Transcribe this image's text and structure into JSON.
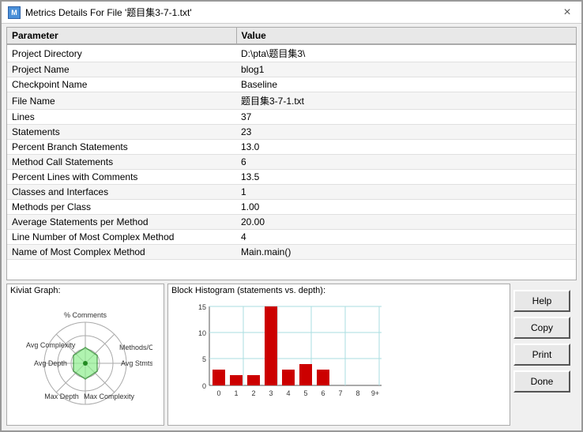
{
  "window": {
    "title": "Metrics Details For File '题目集3-7-1.txt'",
    "close_label": "×"
  },
  "table": {
    "col_param": "Parameter",
    "col_value": "Value",
    "rows": [
      {
        "param": "Project Directory",
        "value": "D:\\pta\\题目集3\\"
      },
      {
        "param": "Project Name",
        "value": "blog1"
      },
      {
        "param": "Checkpoint Name",
        "value": "Baseline"
      },
      {
        "param": "File Name",
        "value": "题目集3-7-1.txt"
      },
      {
        "param": "Lines",
        "value": "37"
      },
      {
        "param": "Statements",
        "value": "23"
      },
      {
        "param": "Percent Branch Statements",
        "value": "13.0"
      },
      {
        "param": "Method Call Statements",
        "value": "6"
      },
      {
        "param": "Percent Lines with Comments",
        "value": "13.5"
      },
      {
        "param": "Classes and Interfaces",
        "value": "1"
      },
      {
        "param": "Methods per Class",
        "value": "1.00"
      },
      {
        "param": "Average Statements per Method",
        "value": "20.00"
      },
      {
        "param": "Line Number of Most Complex Method",
        "value": "4"
      },
      {
        "param": "Name of Most Complex Method",
        "value": "Main.main()"
      }
    ]
  },
  "kiviat": {
    "label": "Kiviat Graph:",
    "labels": {
      "top": "% Comments",
      "top_right": "Methods/Class",
      "right": "Avg Stmts/Method",
      "bottom_right": "Max Complexity",
      "bottom": "Max Depth",
      "bottom_left": "Max Depth",
      "left": "Avg Depth",
      "top_left": "Avg Complexity"
    }
  },
  "histogram": {
    "label": "Block Histogram (statements vs. depth):",
    "x_labels": [
      "0",
      "1",
      "2",
      "3",
      "4",
      "5",
      "6",
      "7",
      "8",
      "9+"
    ],
    "y_max": 15,
    "y_labels": [
      "0",
      "5",
      "10",
      "15"
    ],
    "bars": [
      3,
      2,
      2,
      15,
      3,
      4,
      3,
      0,
      0,
      0
    ]
  },
  "buttons": {
    "help": "Help",
    "copy": "Copy",
    "print": "Print",
    "done": "Done"
  }
}
